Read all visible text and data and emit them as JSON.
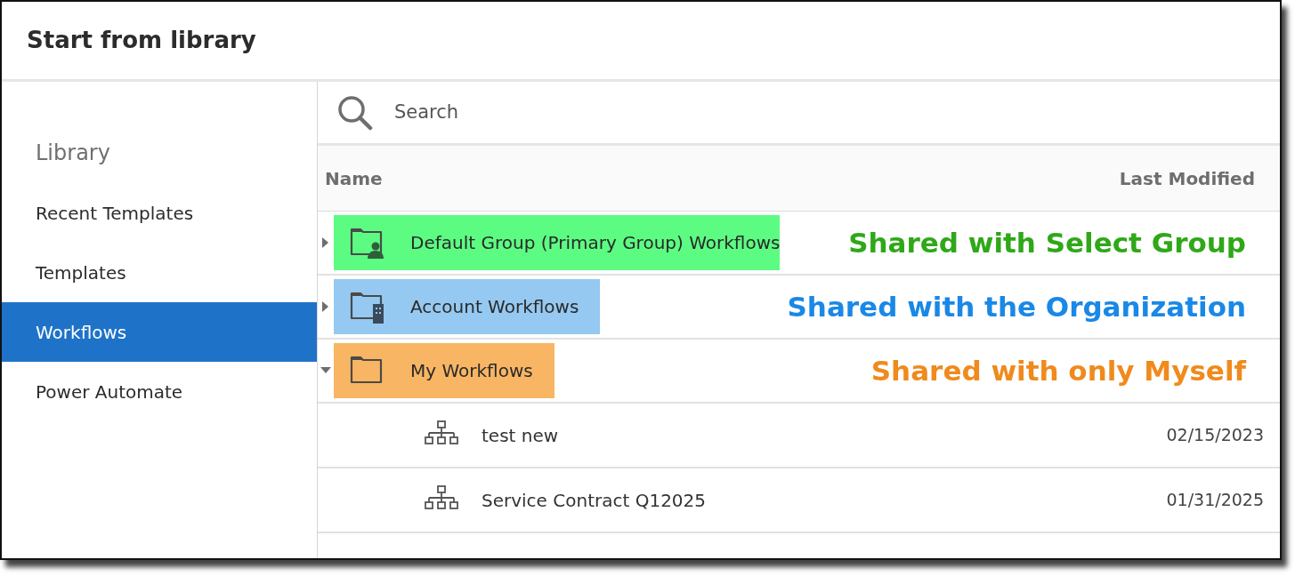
{
  "window": {
    "title": "Start from library"
  },
  "sidebar": {
    "heading": "Library",
    "items": [
      {
        "label": "Recent Templates",
        "selected": false
      },
      {
        "label": "Templates",
        "selected": false
      },
      {
        "label": "Workflows",
        "selected": true
      },
      {
        "label": "Power Automate",
        "selected": false
      }
    ]
  },
  "search": {
    "placeholder": "Search"
  },
  "table": {
    "columns": [
      "Name",
      "Last Modified"
    ],
    "rows": [
      {
        "name": "Default Group (Primary Group) Workflows",
        "kind": "group-folder",
        "expanded": false,
        "color": "#5cfc82",
        "annotation": {
          "text": "Shared with Select Group",
          "color": "#2fa818"
        },
        "children": []
      },
      {
        "name": "Account Workflows",
        "kind": "org-folder",
        "expanded": false,
        "color": "#95c9f1",
        "annotation": {
          "text": "Shared with the Organization",
          "color": "#1a88e6"
        },
        "children": []
      },
      {
        "name": "My Workflows",
        "kind": "folder",
        "expanded": true,
        "color": "#f8b563",
        "annotation": {
          "text": "Shared with only Myself",
          "color": "#f08a1c"
        },
        "children": [
          {
            "name": "test new",
            "kind": "workflow",
            "modified": "02/15/2023"
          },
          {
            "name": "Service Contract Q12025",
            "kind": "workflow",
            "modified": "01/31/2025"
          }
        ]
      }
    ]
  }
}
